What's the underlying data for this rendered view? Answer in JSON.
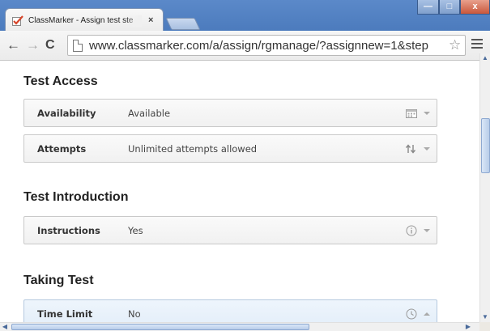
{
  "browser": {
    "tab_title": "ClassMarker - Assign test ste",
    "tab_close": "×",
    "url": "www.classmarker.com/a/assign/rgmanage/?assignnew=1&step",
    "icons": {
      "back": "back-arrow-icon",
      "forward": "forward-arrow-icon",
      "reload": "reload-icon",
      "page": "page-icon",
      "star": "bookmark-star-icon",
      "menu": "menu-icon"
    },
    "window_controls": {
      "minimize": "—",
      "maximize": "□",
      "close": "x"
    }
  },
  "sections": [
    {
      "title": "Test Access",
      "rows": [
        {
          "label": "Availability",
          "value": "Available",
          "icon": "calendar-icon"
        },
        {
          "label": "Attempts",
          "value": "Unlimited attempts allowed",
          "icon": "repeat-icon"
        }
      ]
    },
    {
      "title": "Test Introduction",
      "rows": [
        {
          "label": "Instructions",
          "value": "Yes",
          "icon": "info-icon"
        }
      ]
    },
    {
      "title": "Taking Test",
      "rows": [
        {
          "label": "Time Limit",
          "value": "No",
          "icon": "clock-icon",
          "expanded": true
        }
      ]
    }
  ],
  "colors": {
    "chrome_titlebar": "#4c7bbd",
    "card_border": "#c9c9c9",
    "card_highlight": "#e3eef9",
    "brand_check": "#d6452a"
  }
}
